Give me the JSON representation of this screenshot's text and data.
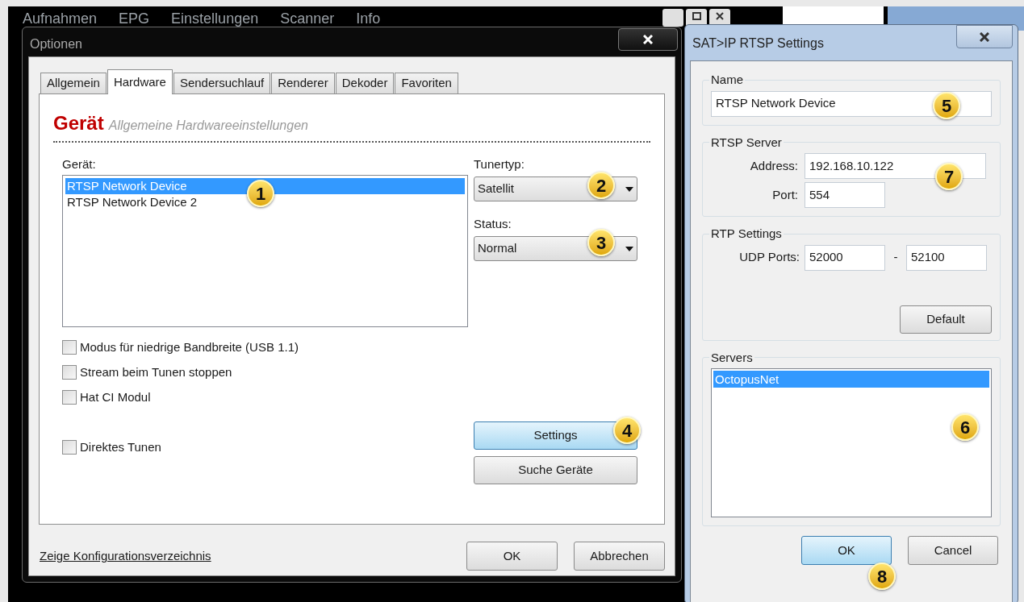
{
  "app": {
    "menu": [
      "Aufnahmen",
      "EPG",
      "Einstellungen",
      "Scanner",
      "Info"
    ]
  },
  "options_dialog": {
    "title": "Optionen",
    "tabs": [
      {
        "label": "Allgemein",
        "selected": false
      },
      {
        "label": "Hardware",
        "selected": true
      },
      {
        "label": "Sendersuchlauf",
        "selected": false
      },
      {
        "label": "Renderer",
        "selected": false
      },
      {
        "label": "Dekoder",
        "selected": false
      },
      {
        "label": "Favoriten",
        "selected": false
      }
    ],
    "header": {
      "title": "Gerät",
      "subtitle": "Allgemeine Hardwareeinstellungen"
    },
    "device_label": "Gerät:",
    "devices": [
      {
        "label": "RTSP Network Device",
        "selected": true
      },
      {
        "label": "RTSP Network Device 2",
        "selected": false
      }
    ],
    "checkboxes": [
      {
        "label": "Modus für niedrige Bandbreite (USB 1.1)",
        "checked": false
      },
      {
        "label": "Stream beim Tunen stoppen",
        "checked": false
      },
      {
        "label": "Hat CI Modul",
        "checked": false
      }
    ],
    "extra_checkbox": {
      "label": "Direktes Tunen",
      "checked": false
    },
    "tuner_type": {
      "label": "Tunertyp:",
      "value": "Satellit"
    },
    "status": {
      "label": "Status:",
      "value": "Normal"
    },
    "buttons": [
      {
        "label": "Settings",
        "focused": true
      },
      {
        "label": "Suche Geräte",
        "focused": false
      }
    ],
    "link": "Zeige Konfigurationsverzeichnis",
    "footer_buttons": [
      {
        "label": "OK",
        "focused": false
      },
      {
        "label": "Abbrechen",
        "focused": false
      }
    ]
  },
  "rtsp_dialog": {
    "title": "SAT>IP RTSP Settings",
    "name_group": {
      "label": "Name",
      "value": "RTSP Network Device"
    },
    "server_group": {
      "label": "RTSP Server",
      "address_label": "Address:",
      "address": "192.168.10.122",
      "port_label": "Port:",
      "port": "554"
    },
    "rtp_group": {
      "label": "RTP Settings",
      "udp_label": "UDP Ports:",
      "udp_from": "52000",
      "separator": "-",
      "udp_to": "52100",
      "default_button": "Default"
    },
    "servers_group": {
      "label": "Servers",
      "items": [
        {
          "label": "OctopusNet",
          "selected": true
        }
      ]
    },
    "buttons": [
      {
        "label": "OK",
        "focused": true
      },
      {
        "label": "Cancel",
        "focused": false
      }
    ]
  },
  "callouts": [
    "1",
    "2",
    "3",
    "4",
    "5",
    "6",
    "7",
    "8"
  ]
}
